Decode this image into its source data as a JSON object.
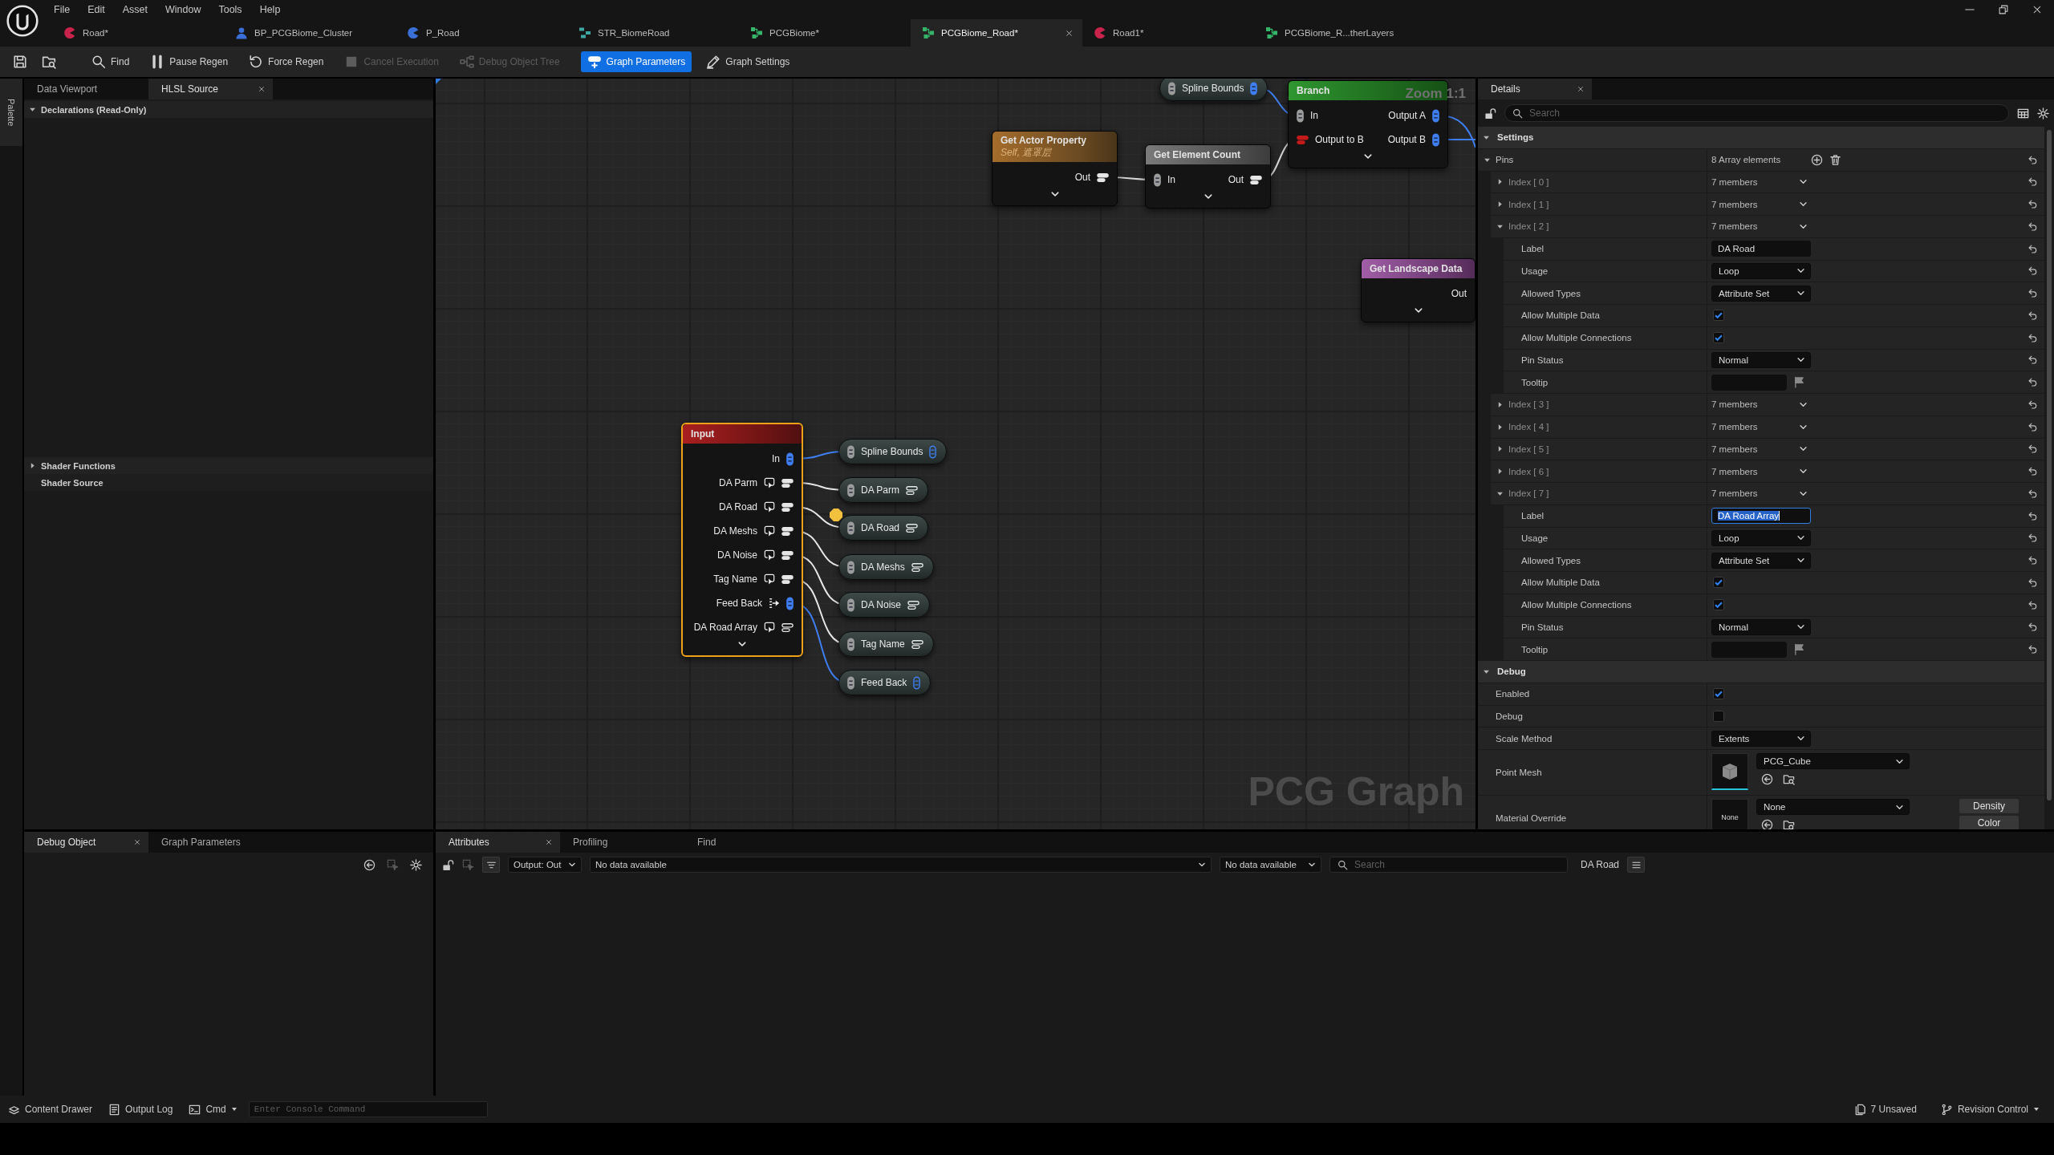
{
  "menu": [
    "File",
    "Edit",
    "Asset",
    "Window",
    "Tools",
    "Help"
  ],
  "document_tabs": [
    {
      "label": "Road*",
      "kind": "level",
      "selected": false
    },
    {
      "label": "BP_PCGBiome_Cluster",
      "kind": "blueprint",
      "selected": false
    },
    {
      "label": "P_Road",
      "kind": "actor",
      "selected": false
    },
    {
      "label": "STR_BiomeRoad",
      "kind": "struct",
      "selected": false
    },
    {
      "label": "PCGBiome*",
      "kind": "pcg_graph",
      "selected": false
    },
    {
      "label": "PCGBiome_Road*",
      "kind": "pcg_graph",
      "selected": true
    },
    {
      "label": "Road1*",
      "kind": "level",
      "selected": false
    },
    {
      "label": "PCGBiome_R...therLayers",
      "kind": "pcg_graph",
      "selected": false
    }
  ],
  "toolbar": [
    {
      "kind": "save",
      "selected": false,
      "disabled": false
    },
    {
      "kind": "browse",
      "selected": false,
      "disabled": false
    },
    {
      "kind": "find",
      "label": "Find",
      "selected": false,
      "disabled": false
    },
    {
      "kind": "pause_regen",
      "label": "Pause Regen",
      "selected": false,
      "disabled": false
    },
    {
      "kind": "force_regen",
      "label": "Force Regen",
      "selected": false,
      "disabled": false
    },
    {
      "kind": "cancel_execution",
      "label": "Cancel Execution",
      "selected": false,
      "disabled": true
    },
    {
      "kind": "debug_object_tree",
      "label": "Debug Object Tree",
      "selected": false,
      "disabled": true
    },
    {
      "kind": "graph_parameters",
      "label": "Graph Parameters",
      "selected": true,
      "disabled": false
    },
    {
      "kind": "graph_settings",
      "label": "Graph Settings",
      "selected": false,
      "disabled": false
    }
  ],
  "palette": {
    "label": "Palette"
  },
  "source_panel": {
    "tabs": [
      {
        "label": "Data Viewport",
        "selected": false
      },
      {
        "label": "HLSL Source",
        "selected": true
      }
    ],
    "sections": [
      {
        "kind": "category",
        "label": "Declarations (Read-Only)",
        "expanded": true
      },
      {
        "kind": "category",
        "label": "Shader Functions",
        "expanded": false
      },
      {
        "kind": "plain",
        "label": "Shader Source"
      }
    ]
  },
  "graph": {
    "title": "PCG Graph",
    "zoom": "Zoom 1:1",
    "nodes": [
      {
        "kind": "named_reroute",
        "title": "Spline Bounds",
        "pin": {
          "kind": "spatial",
          "connected": true
        },
        "selected": false,
        "inspected": false
      },
      {
        "kind": "param",
        "title": "Get Actor Property",
        "subtitle": "Self, 遮罩层",
        "selected": false,
        "inspected": false,
        "outputs": [
          {
            "label": "Out",
            "kind": "param",
            "connected": true
          }
        ]
      },
      {
        "kind": "generic",
        "title": "Get Element Count",
        "selected": false,
        "inspected": false,
        "inputs": [
          {
            "label": "In",
            "kind": "any",
            "connected": true
          }
        ],
        "outputs": [
          {
            "label": "Out",
            "kind": "param",
            "connected": true
          }
        ]
      },
      {
        "kind": "control_flow",
        "title": "Branch",
        "selected": false,
        "inspected": false,
        "inputs": [
          {
            "label": "In",
            "kind": "any",
            "connected": true
          },
          {
            "label": "Output to B",
            "kind": "bool",
            "connected": true
          }
        ],
        "outputs": [
          {
            "label": "Output A",
            "kind": "spatial",
            "connected": true
          },
          {
            "label": "Output B",
            "kind": "spatial",
            "connected": true
          }
        ]
      },
      {
        "kind": "spatial",
        "title": "Get Landscape Data",
        "selected": false,
        "inspected": false,
        "outputs": [
          {
            "label": "Out"
          }
        ]
      },
      {
        "kind": "io",
        "title": "Input",
        "selected": true,
        "inspected": false,
        "outputs": [
          {
            "label": "In",
            "kind": "spatial",
            "loop": false,
            "feedback": false,
            "connected": true
          },
          {
            "label": "DA Parm",
            "kind": "param",
            "loop": true,
            "feedback": false,
            "connected": true
          },
          {
            "label": "DA Road",
            "kind": "param",
            "loop": true,
            "feedback": false,
            "connected": true
          },
          {
            "label": "DA Meshs",
            "kind": "param",
            "loop": true,
            "feedback": false,
            "connected": true
          },
          {
            "label": "DA Noise",
            "kind": "param",
            "loop": true,
            "feedback": false,
            "connected": true
          },
          {
            "label": "Tag Name",
            "kind": "param",
            "loop": true,
            "feedback": false,
            "connected": true
          },
          {
            "label": "Feed Back",
            "kind": "spatial",
            "loop": false,
            "feedback": true,
            "connected": true
          },
          {
            "label": "DA Road Array",
            "kind": "param",
            "loop": true,
            "feedback": false,
            "connected": false
          }
        ]
      },
      {
        "kind": "named_reroute",
        "title": "Spline Bounds",
        "pin": {
          "kind": "spatial",
          "connected": false
        },
        "selected": false,
        "inspected": false
      },
      {
        "kind": "named_reroute",
        "title": "DA Parm",
        "pin": {
          "kind": "param",
          "connected": false
        },
        "selected": false,
        "inspected": false
      },
      {
        "kind": "named_reroute",
        "title": "DA Road",
        "pin": {
          "kind": "param",
          "connected": false
        },
        "selected": false,
        "inspected": true
      },
      {
        "kind": "named_reroute",
        "title": "DA Meshs",
        "pin": {
          "kind": "param",
          "connected": false
        },
        "selected": false,
        "inspected": false
      },
      {
        "kind": "named_reroute",
        "title": "DA Noise",
        "pin": {
          "kind": "param",
          "connected": false
        },
        "selected": false,
        "inspected": false
      },
      {
        "kind": "named_reroute",
        "title": "Tag Name",
        "pin": {
          "kind": "param",
          "connected": false
        },
        "selected": false,
        "inspected": false
      },
      {
        "kind": "named_reroute",
        "title": "Feed Back",
        "pin": {
          "kind": "spatial",
          "connected": false
        },
        "selected": false,
        "inspected": false
      }
    ]
  },
  "details": {
    "tabs": [
      {
        "label": "Details",
        "selected": true
      }
    ],
    "search": {
      "placeholder": "Search"
    },
    "categories": [
      {
        "label": "Settings",
        "expanded": true,
        "rows": [
          {
            "kind": "array",
            "label": "Pins",
            "value": "8 Array elements",
            "expanded": true,
            "modified": true,
            "children": [
              {
                "kind": "struct",
                "label": "Index [ 0 ]",
                "value": "7 members",
                "expanded": false,
                "modified": true
              },
              {
                "kind": "struct",
                "label": "Index [ 1 ]",
                "value": "7 members",
                "expanded": false,
                "modified": true
              },
              {
                "kind": "struct",
                "label": "Index [ 2 ]",
                "value": "7 members",
                "expanded": true,
                "modified": true,
                "children": [
                  {
                    "kind": "text",
                    "label": "Label",
                    "value": "DA Road",
                    "focused": false,
                    "modified": true
                  },
                  {
                    "kind": "dropdown",
                    "label": "Usage",
                    "value": "Loop",
                    "modified": true
                  },
                  {
                    "kind": "dropdown",
                    "label": "Allowed Types",
                    "value": "Attribute Set",
                    "modified": true
                  },
                  {
                    "kind": "checkbox",
                    "label": "Allow Multiple Data",
                    "checked": true,
                    "modified": true
                  },
                  {
                    "kind": "checkbox",
                    "label": "Allow Multiple Connections",
                    "checked": true,
                    "modified": true
                  },
                  {
                    "kind": "dropdown",
                    "label": "Pin Status",
                    "value": "Normal",
                    "modified": true
                  },
                  {
                    "kind": "tooltip",
                    "label": "Tooltip",
                    "modified": true
                  }
                ]
              },
              {
                "kind": "struct",
                "label": "Index [ 3 ]",
                "value": "7 members",
                "expanded": false,
                "modified": true
              },
              {
                "kind": "struct",
                "label": "Index [ 4 ]",
                "value": "7 members",
                "expanded": false,
                "modified": true
              },
              {
                "kind": "struct",
                "label": "Index [ 5 ]",
                "value": "7 members",
                "expanded": false,
                "modified": true
              },
              {
                "kind": "struct",
                "label": "Index [ 6 ]",
                "value": "7 members",
                "expanded": false,
                "modified": true
              },
              {
                "kind": "struct",
                "label": "Index [ 7 ]",
                "value": "7 members",
                "expanded": true,
                "modified": true,
                "children": [
                  {
                    "kind": "text",
                    "label": "Label",
                    "value": "DA Road Array",
                    "focused": true,
                    "modified": true
                  },
                  {
                    "kind": "dropdown",
                    "label": "Usage",
                    "value": "Loop",
                    "modified": true
                  },
                  {
                    "kind": "dropdown",
                    "label": "Allowed Types",
                    "value": "Attribute Set",
                    "modified": true
                  },
                  {
                    "kind": "checkbox",
                    "label": "Allow Multiple Data",
                    "checked": true,
                    "modified": true
                  },
                  {
                    "kind": "checkbox",
                    "label": "Allow Multiple Connections",
                    "checked": true,
                    "modified": true
                  },
                  {
                    "kind": "dropdown",
                    "label": "Pin Status",
                    "value": "Normal",
                    "modified": true
                  },
                  {
                    "kind": "tooltip",
                    "label": "Tooltip",
                    "modified": true
                  }
                ]
              }
            ]
          }
        ]
      },
      {
        "label": "Debug",
        "expanded": true,
        "rows": [
          {
            "kind": "checkbox",
            "label": "Enabled",
            "checked": true,
            "modified": false
          },
          {
            "kind": "checkbox",
            "label": "Debug",
            "checked": false,
            "modified": false
          },
          {
            "kind": "dropdown",
            "label": "Scale Method",
            "value": "Extents",
            "modified": false
          },
          {
            "kind": "mesh_asset",
            "label": "Point Mesh",
            "value": "PCG_Cube",
            "modified": false
          },
          {
            "kind": "material_asset",
            "label": "Material Override",
            "value": "None",
            "preview_label": "None",
            "buttons": [
              "Density",
              "Color"
            ],
            "modified": false
          }
        ]
      }
    ]
  },
  "debug_panel": {
    "tabs": [
      {
        "label": "Debug Object",
        "selected": true
      },
      {
        "label": "Graph Parameters",
        "selected": false
      }
    ]
  },
  "attributes_panel": {
    "tabs": [
      {
        "label": "Attributes",
        "selected": true
      },
      {
        "label": "Profiling",
        "selected": false
      },
      {
        "label": "Find",
        "selected": false
      }
    ],
    "output_select": "Output: Out",
    "data_select": "No data available",
    "data_select_2": "No data available",
    "search": {
      "placeholder": "Search"
    },
    "inspected_label": "DA Road"
  },
  "status_bar": {
    "left": [
      {
        "kind": "content_drawer",
        "label": "Content Drawer"
      },
      {
        "kind": "output_log",
        "label": "Output Log"
      },
      {
        "kind": "cmd",
        "label": "Cmd"
      }
    ],
    "console": {
      "placeholder": "Enter Console Command"
    },
    "right": [
      {
        "kind": "unsaved",
        "label": "7 Unsaved"
      },
      {
        "kind": "revision_control",
        "label": "Revision Control"
      }
    ]
  }
}
